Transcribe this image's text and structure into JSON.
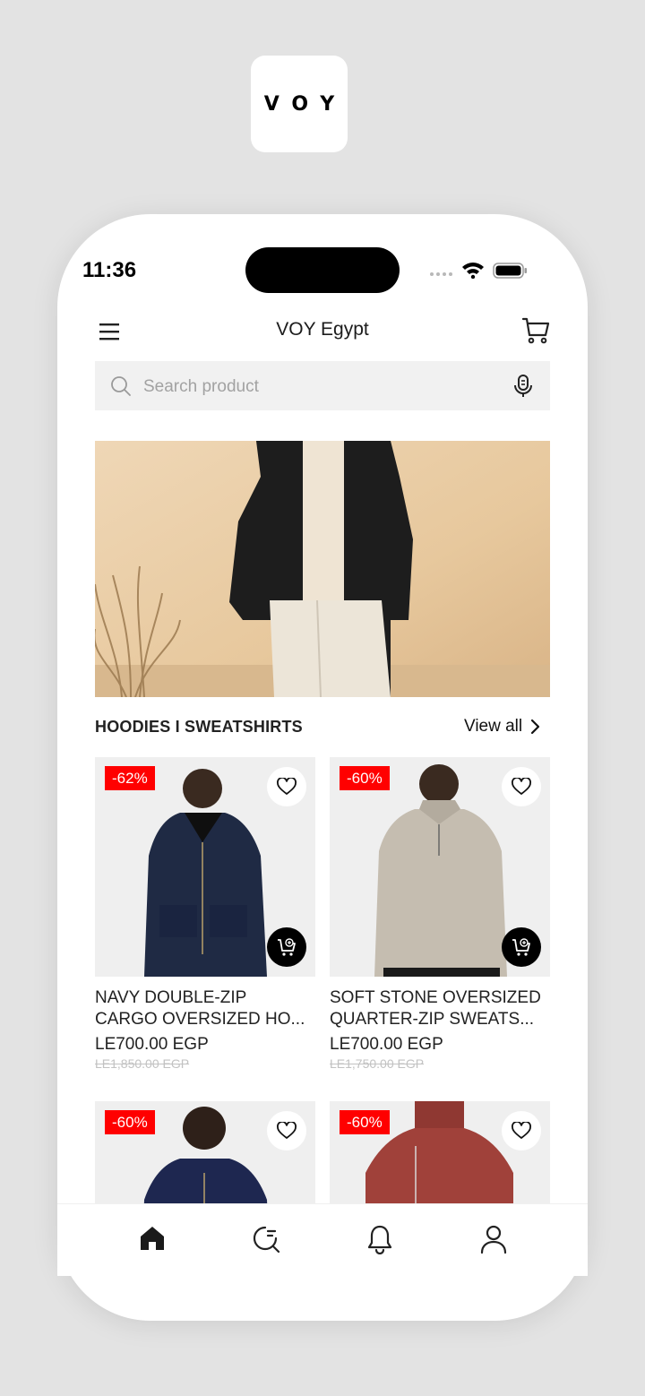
{
  "brand": {
    "logo_text": "VOY"
  },
  "status_bar": {
    "time": "11:36"
  },
  "header": {
    "title": "VOY Egypt"
  },
  "search": {
    "placeholder": "Search product"
  },
  "section": {
    "title": "HOODIES I SWEATSHIRTS",
    "view_all_label": "View all"
  },
  "products": [
    {
      "badge": "-62%",
      "name_line1": "NAVY DOUBLE-ZIP",
      "name_line2": "CARGO OVERSIZED HO...",
      "price": "LE700.00 EGP",
      "old_price": "LE1,850.00 EGP",
      "color": "#1f2a44"
    },
    {
      "badge": "-60%",
      "name_line1": "SOFT STONE OVERSIZED",
      "name_line2": "QUARTER-ZIP SWEATS...",
      "price": "LE700.00 EGP",
      "old_price": "LE1,750.00 EGP",
      "color": "#bcb5a8"
    },
    {
      "badge": "-60%",
      "color": "#1e2750"
    },
    {
      "badge": "-60%",
      "color": "#a0413a"
    }
  ],
  "nav": {
    "items": [
      "home-icon",
      "search-icon",
      "bell-icon",
      "user-icon"
    ],
    "active": "home-icon"
  },
  "colors": {
    "accent": "#ff0000",
    "background": "#e3e3e3",
    "search_bg": "#f1f1f1"
  }
}
